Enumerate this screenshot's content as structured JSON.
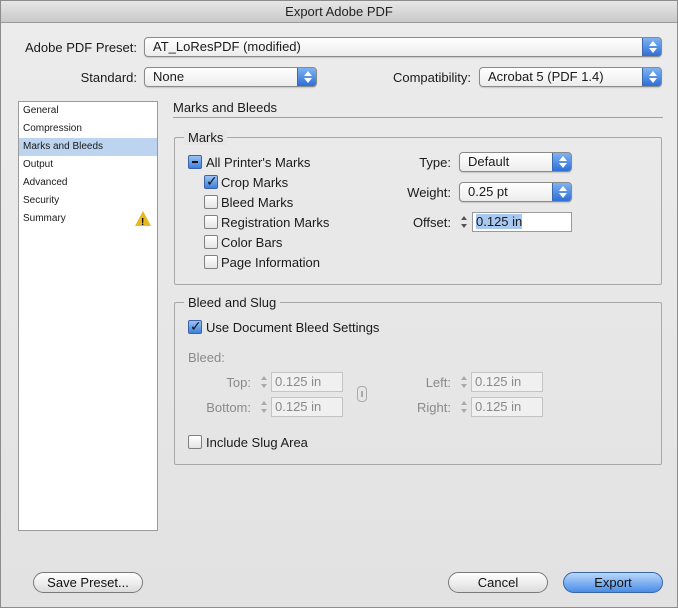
{
  "window": {
    "title": "Export Adobe PDF"
  },
  "preset": {
    "label": "Adobe PDF Preset:",
    "value": "AT_LoResPDF (modified)"
  },
  "standard": {
    "label": "Standard:",
    "value": "None"
  },
  "compatibility": {
    "label": "Compatibility:",
    "value": "Acrobat 5 (PDF 1.4)"
  },
  "sidebar": {
    "items": [
      {
        "label": "General"
      },
      {
        "label": "Compression"
      },
      {
        "label": "Marks and Bleeds",
        "selected": true
      },
      {
        "label": "Output"
      },
      {
        "label": "Advanced"
      },
      {
        "label": "Security"
      },
      {
        "label": "Summary",
        "warning": true
      }
    ],
    "warning_glyph": "!"
  },
  "panel": {
    "title": "Marks and Bleeds"
  },
  "marks": {
    "title": "Marks",
    "all_printers_marks": {
      "label": "All Printer's Marks",
      "state": "mixed"
    },
    "crop_marks": {
      "label": "Crop Marks",
      "checked": true
    },
    "bleed_marks": {
      "label": "Bleed Marks",
      "checked": false
    },
    "registration_marks": {
      "label": "Registration Marks",
      "checked": false
    },
    "color_bars": {
      "label": "Color Bars",
      "checked": false
    },
    "page_information": {
      "label": "Page Information",
      "checked": false
    },
    "type": {
      "label": "Type:",
      "value": "Default"
    },
    "weight": {
      "label": "Weight:",
      "value": "0.25 pt"
    },
    "offset": {
      "label": "Offset:",
      "value": "0.125 in"
    }
  },
  "bleed": {
    "title": "Bleed and Slug",
    "use_document": {
      "label": "Use Document Bleed Settings",
      "checked": true
    },
    "bleed_label": "Bleed:",
    "top": {
      "label": "Top:",
      "value": "0.125 in"
    },
    "bottom": {
      "label": "Bottom:",
      "value": "0.125 in"
    },
    "left": {
      "label": "Left:",
      "value": "0.125 in"
    },
    "right": {
      "label": "Right:",
      "value": "0.125 in"
    },
    "include_slug": {
      "label": "Include Slug Area",
      "checked": false
    }
  },
  "buttons": {
    "save_preset": "Save Preset...",
    "cancel": "Cancel",
    "export": "Export"
  },
  "colors": {
    "accent": "#3d7fdb",
    "selection": "#bcd4ef",
    "warning": "#e8b820"
  }
}
